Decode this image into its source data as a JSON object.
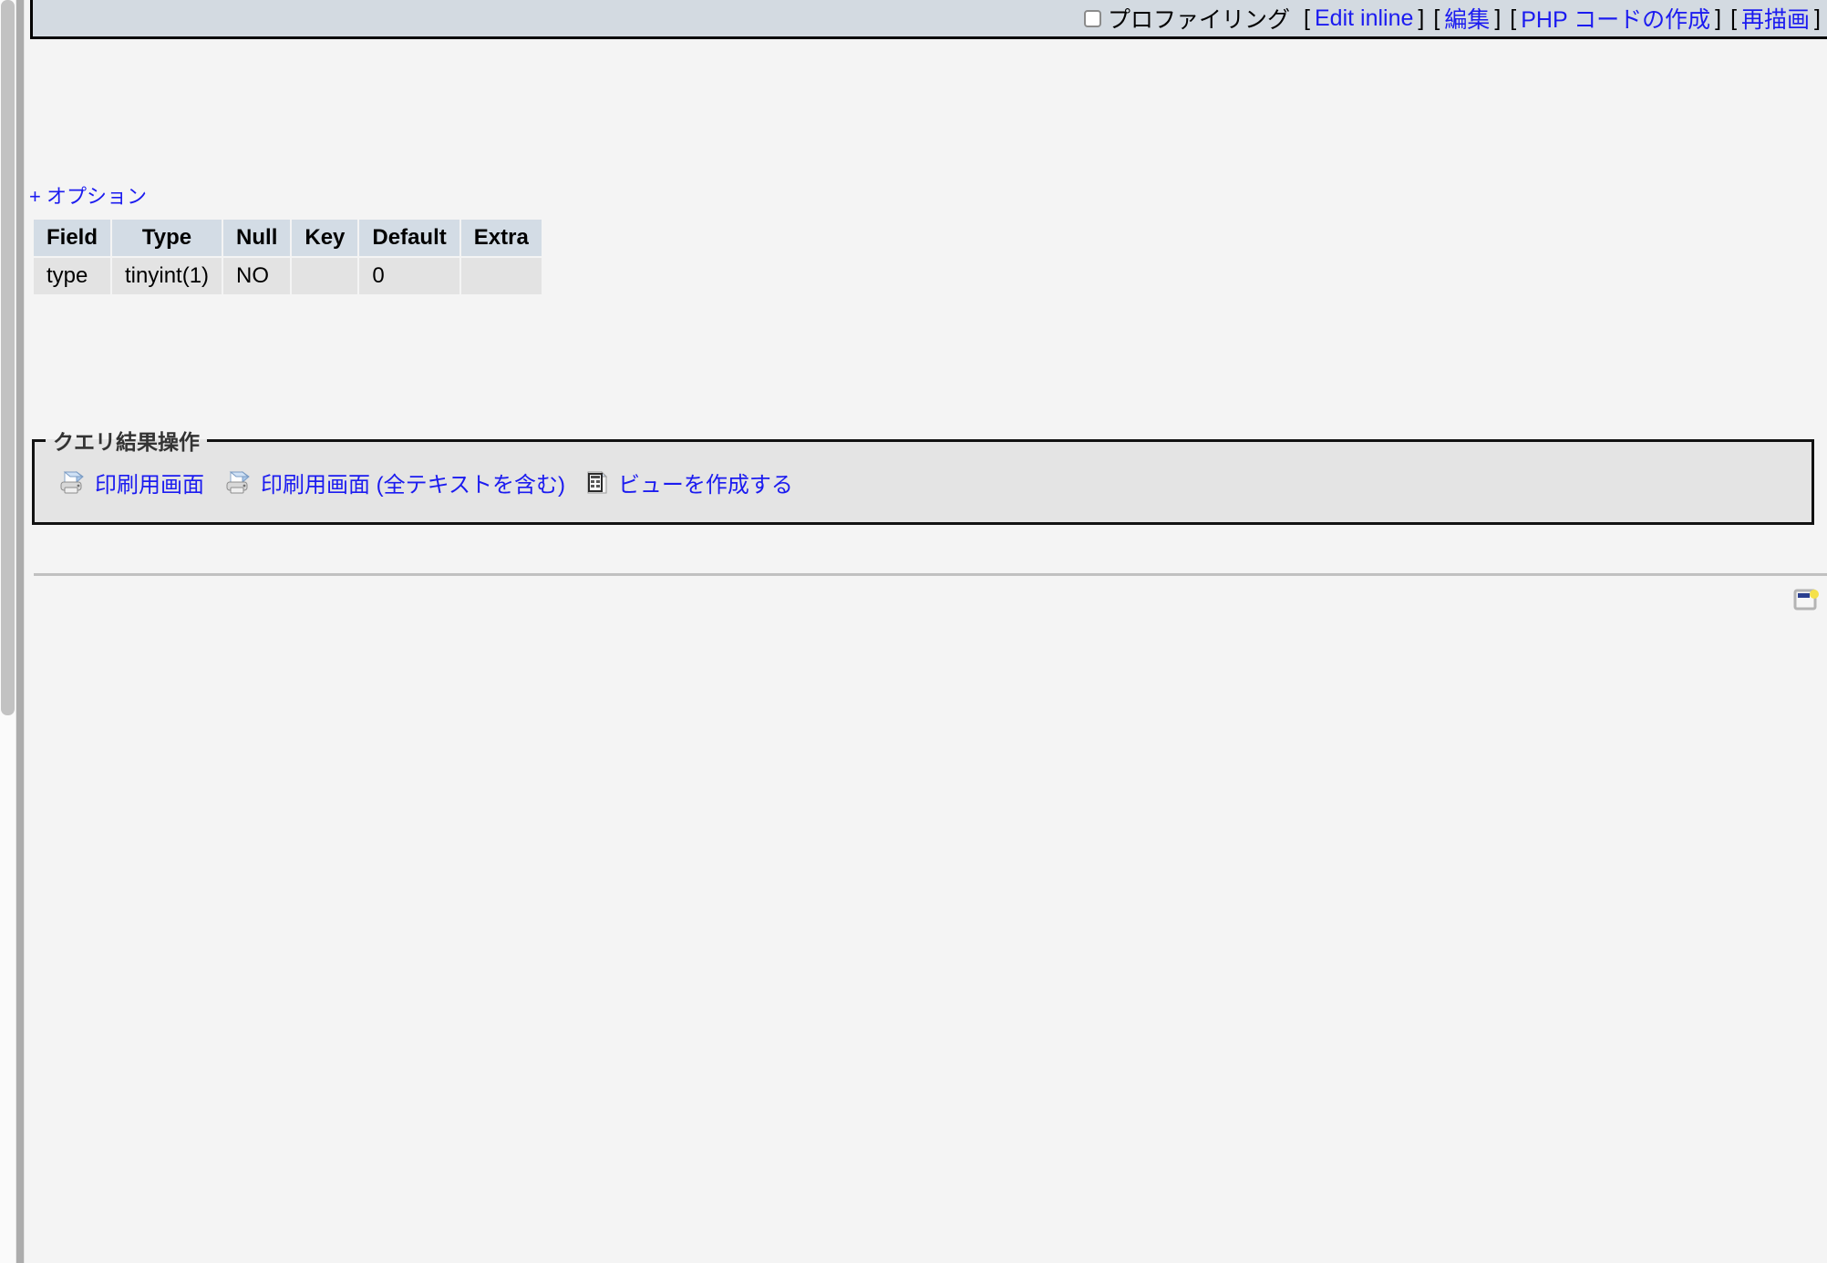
{
  "query_bar": {
    "profiling_label": "プロファイリング",
    "checkbox_checked": false,
    "bracket_open": "[",
    "bracket_close": "]",
    "links": [
      {
        "label": "Edit inline",
        "name": "edit-inline-link"
      },
      {
        "label": "編集",
        "name": "edit-link"
      },
      {
        "label": "PHP コードの作成",
        "name": "create-php-code-link"
      },
      {
        "label": "再描画",
        "name": "refresh-link"
      }
    ]
  },
  "options": {
    "label": "+ オプション"
  },
  "results_table": {
    "columns": [
      "Field",
      "Type",
      "Null",
      "Key",
      "Default",
      "Extra"
    ],
    "rows": [
      {
        "Field": "type",
        "Type": "tinyint(1)",
        "Null": "NO",
        "Key": "",
        "Default": "0",
        "Extra": ""
      }
    ]
  },
  "query_result_operations": {
    "legend": "クエリ結果操作",
    "items": [
      {
        "icon": "printer-icon",
        "label": "印刷用画面"
      },
      {
        "icon": "printer-icon",
        "label": "印刷用画面 (全テキストを含む)"
      },
      {
        "icon": "create-view-icon",
        "label": "ビューを作成する"
      }
    ]
  },
  "footer": {
    "window_icon_name": "new-window-icon"
  },
  "colors": {
    "link": "#1b1bf0",
    "bar_background": "#d3dae1",
    "table_header": "#d3dce5",
    "table_cell": "#e3e3e3",
    "fieldset_background": "#e4e4e4",
    "page_background": "#f4f4f4"
  }
}
